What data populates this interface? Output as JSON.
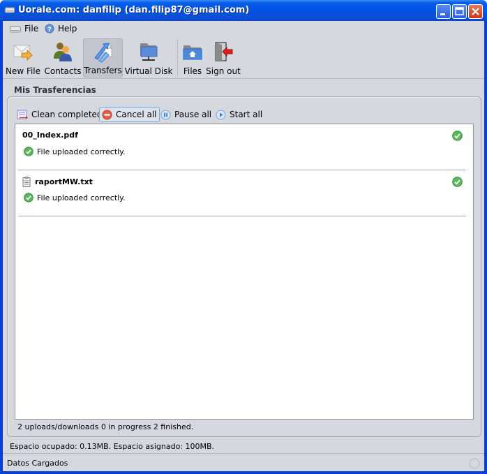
{
  "window": {
    "title": "Uorale.com: danfilip (dan.filip87@gmail.com)",
    "controls": [
      "minimize",
      "maximize",
      "close"
    ]
  },
  "menu": {
    "items": [
      {
        "label": "File",
        "icon": "drive-icon"
      },
      {
        "label": "Help",
        "icon": "help-icon"
      }
    ]
  },
  "toolbar": {
    "items": [
      {
        "label": "New File",
        "icon": "new-file-icon",
        "active": false
      },
      {
        "label": "Contacts",
        "icon": "contacts-icon",
        "active": false
      },
      {
        "label": "Transfers",
        "icon": "transfers-icon",
        "active": true
      },
      {
        "label": "Virtual Disk",
        "icon": "virtual-disk-icon",
        "active": false
      },
      {
        "label": "Files",
        "icon": "files-folder-icon",
        "active": false
      },
      {
        "label": "Sign out",
        "icon": "sign-out-icon",
        "active": false
      }
    ]
  },
  "transfers": {
    "section_title": "Mis Trasferencias",
    "actions": {
      "clean": "Clean completed",
      "cancel": "Cancel all",
      "pause": "Pause all",
      "start": "Start all"
    },
    "items": [
      {
        "name": "00_Index.pdf",
        "status": "File uploaded correctly.",
        "has_file_icon": false
      },
      {
        "name": "raportMW.txt",
        "status": "File uploaded correctly.",
        "has_file_icon": true
      }
    ],
    "summary": "2 uploads/downloads 0 in progress 2 finished."
  },
  "footer": {
    "space_info": "Espacio ocupado: 0.13MB. Espacio asignado: 100MB.",
    "status": "Datos Cargados"
  },
  "colors": {
    "titlebar": "#0055e5",
    "client_bg": "#d6d8df",
    "success": "#4caf50",
    "cancel": "#e04a3a",
    "pause_start": "#4a8ad8"
  }
}
